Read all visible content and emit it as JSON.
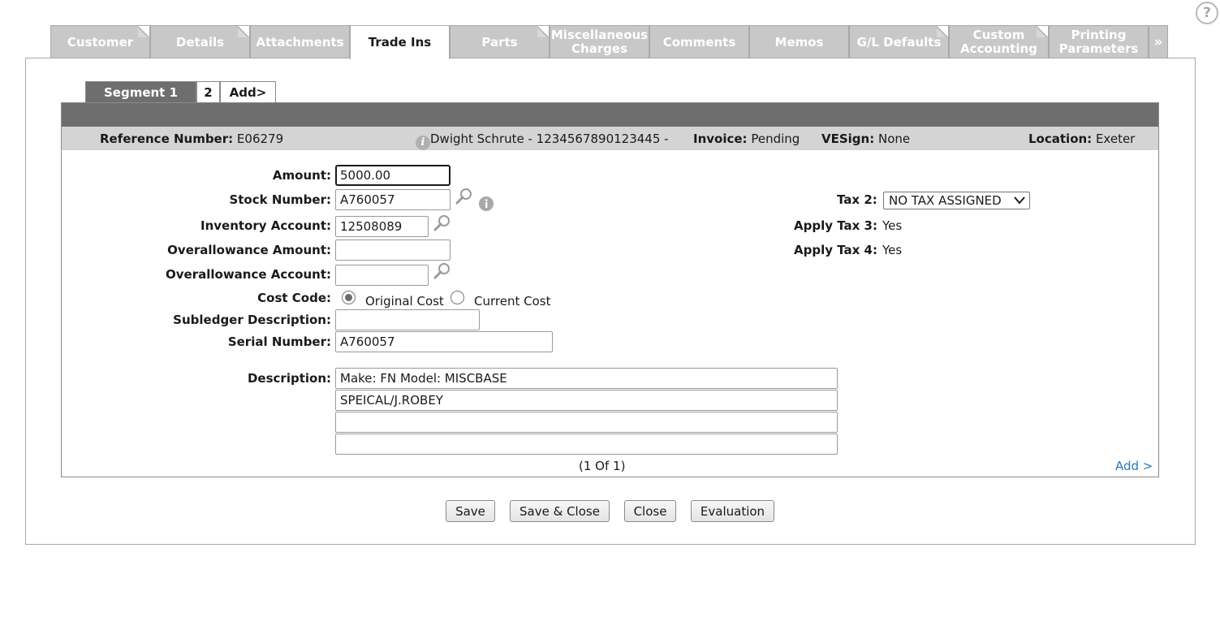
{
  "tabs": [
    {
      "label": "Customer",
      "active": false
    },
    {
      "label": "Details",
      "active": false
    },
    {
      "label": "Attachments",
      "active": false
    },
    {
      "label": "Trade Ins",
      "active": true
    },
    {
      "label": "Parts",
      "active": false
    },
    {
      "label": "Miscellaneous Charges",
      "active": false
    },
    {
      "label": "Comments",
      "active": false
    },
    {
      "label": "Memos",
      "active": false
    },
    {
      "label": "G/L Defaults",
      "active": false
    },
    {
      "label": "Custom Accounting",
      "active": false
    },
    {
      "label": "Printing Parameters",
      "active": false
    }
  ],
  "tabs_more": "»",
  "help_icon": "?",
  "segments": {
    "active": "Segment 1",
    "second": "2",
    "add": "Add>"
  },
  "info": {
    "reference_label": "Reference Number:",
    "reference_value": "E06279",
    "customer": "Dwight Schrute - 1234567890123445  -",
    "invoice_label": "Invoice:",
    "invoice_value": "Pending",
    "vesign_label": "VESign:",
    "vesign_value": "None",
    "location_label": "Location:",
    "location_value": "Exeter"
  },
  "form": {
    "amount_label": "Amount:",
    "amount_value": "5000.00",
    "stock_label": "Stock Number:",
    "stock_value": "A760057",
    "inventory_label": "Inventory Account:",
    "inventory_value": "12508089",
    "overallowance_amount_label": "Overallowance Amount:",
    "overallowance_amount_value": "",
    "overallowance_account_label": "Overallowance Account:",
    "overallowance_account_value": "",
    "cost_code_label": "Cost Code:",
    "cost_original": "Original Cost",
    "cost_current": "Current Cost",
    "cost_selected": "Original Cost",
    "subledger_label": "Subledger Description:",
    "subledger_value": "",
    "serial_label": "Serial Number:",
    "serial_value": "A760057",
    "description_label": "Description:",
    "description_lines": [
      "Make: FN     Model: MISCBASE",
      "SPEICAL/J.ROBEY",
      "",
      ""
    ],
    "pager": "(1   Of  1)",
    "add_link": "Add >"
  },
  "tax": {
    "tax2_label": "Tax 2:",
    "tax2_value": "NO TAX ASSIGNED",
    "tax3_label": "Apply Tax 3:",
    "tax3_value": "Yes",
    "tax4_label": "Apply Tax 4:",
    "tax4_value": "Yes"
  },
  "buttons": {
    "save": "Save",
    "save_close": "Save & Close",
    "close": "Close",
    "evaluation": "Evaluation"
  }
}
